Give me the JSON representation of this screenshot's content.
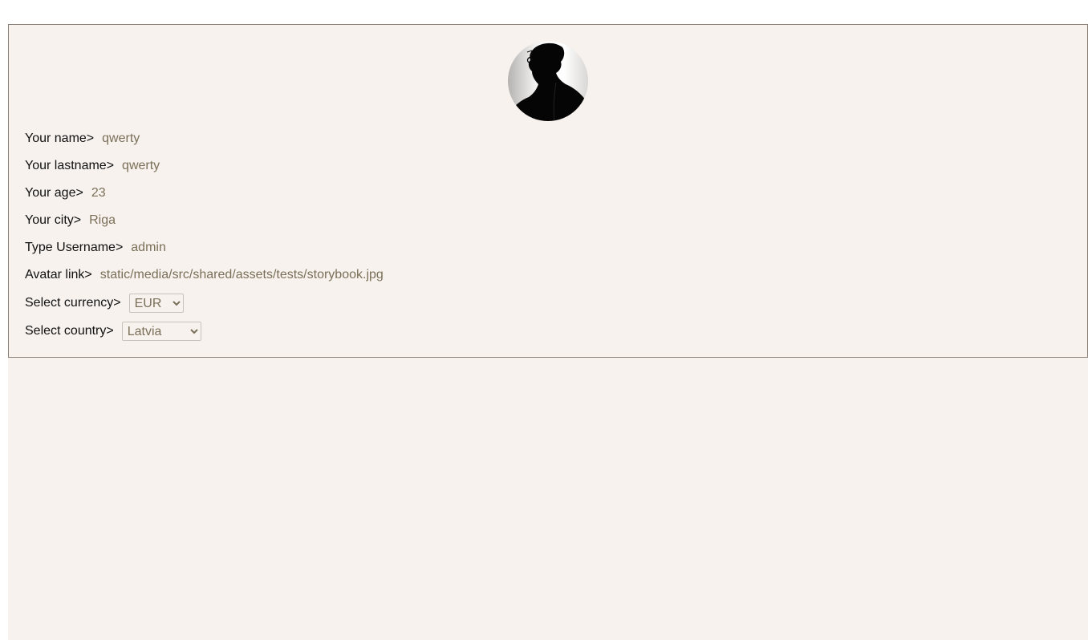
{
  "profile": {
    "fields": [
      {
        "label": "Your name>",
        "value": "qwerty"
      },
      {
        "label": "Your lastname>",
        "value": "qwerty"
      },
      {
        "label": "Your age>",
        "value": "23"
      },
      {
        "label": "Your city>",
        "value": "Riga"
      },
      {
        "label": "Type Username>",
        "value": "admin"
      },
      {
        "label": "Avatar link>",
        "value": "static/media/src/shared/assets/tests/storybook.jpg"
      }
    ],
    "currency": {
      "label": "Select currency>",
      "selected": "EUR",
      "options": [
        "EUR"
      ]
    },
    "country": {
      "label": "Select country>",
      "selected": "Latvia",
      "options": [
        "Latvia"
      ]
    }
  },
  "colors": {
    "background": "#f7f2ee",
    "border": "#8a7f77",
    "input_text": "#7a6f58",
    "label_text": "#111111"
  }
}
